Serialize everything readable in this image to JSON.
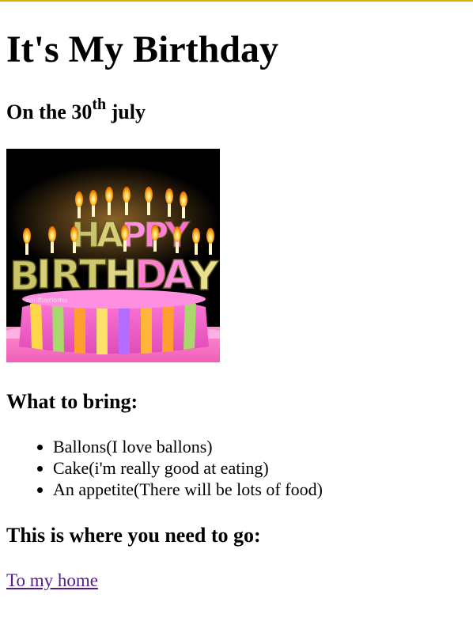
{
  "colors": {
    "top_border": "#d9b300",
    "link": "#551a8b",
    "text": "#000000",
    "background": "#ffffff"
  },
  "page": {
    "title": "It's My Birthday",
    "date_prefix": "On the 30",
    "date_sup": "th",
    "date_suffix": " july",
    "image": {
      "icon": "birthday-cake-image",
      "cake_text_line1": "HAPPY",
      "cake_text_line2": "BIRTHDAY",
      "watermark": "emilfuvriomu"
    },
    "bring_heading": "What to bring:",
    "bring_items": [
      "Ballons(I love ballons)",
      "Cake(i'm really good at eating)",
      "An appetite(There will be lots of food)"
    ],
    "go_heading": "This is where you need to go:",
    "link_text": "To my home"
  }
}
